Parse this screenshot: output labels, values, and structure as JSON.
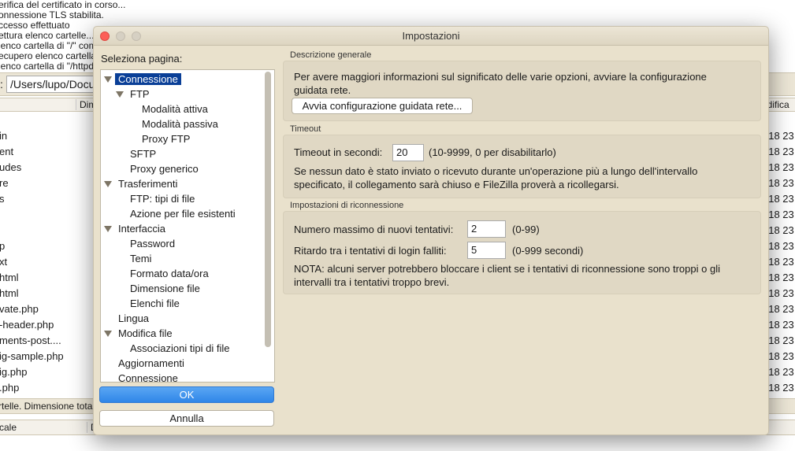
{
  "background": {
    "log_lines": [
      "erifica del certificato in corso...",
      "onnessione TLS stabilita.",
      "ccesso effettuato",
      "ettura elenco cartelle...",
      "lenco cartella di \"/\" com",
      "ecupero elenco cartella",
      "lenco cartella di \"/httpd"
    ],
    "path_label": ":",
    "path_value": "/Users/lupo/Docur",
    "col_name": "",
    "col_size": "Dim",
    "col_modified": "odifica",
    "files": [
      "in",
      "ent",
      "udes",
      "re",
      "s",
      "",
      "",
      "p",
      "xt",
      "html",
      "html",
      "vate.php",
      "-header.php",
      "ments-post....",
      "ig-sample.php",
      "ig.php",
      ".php"
    ],
    "dates": [
      "018 23",
      "018 23",
      "018 23",
      "018 23",
      "018 23",
      "018 23",
      "018 23",
      "018 23",
      "018 23",
      "018 23",
      "018 23",
      "018 23",
      "018 23",
      "018 23",
      "018 23",
      "018 23",
      "018 23"
    ],
    "status": "rtelle. Dimensione tota",
    "bottom_col1": "cale",
    "bottom_col2": "D"
  },
  "dialog": {
    "title": "Impostazioni",
    "select_page_label": "Seleziona pagina:",
    "tree": [
      {
        "label": "Connessione",
        "level": 0,
        "expanded": true,
        "selected": true
      },
      {
        "label": "FTP",
        "level": 1,
        "expanded": true
      },
      {
        "label": "Modalità attiva",
        "level": 2
      },
      {
        "label": "Modalità passiva",
        "level": 2
      },
      {
        "label": "Proxy FTP",
        "level": 2
      },
      {
        "label": "SFTP",
        "level": 1
      },
      {
        "label": "Proxy generico",
        "level": 1
      },
      {
        "label": "Trasferimenti",
        "level": 0,
        "expanded": true
      },
      {
        "label": "FTP: tipi di file",
        "level": 1
      },
      {
        "label": "Azione per file esistenti",
        "level": 1
      },
      {
        "label": "Interfaccia",
        "level": 0,
        "expanded": true
      },
      {
        "label": "Password",
        "level": 1
      },
      {
        "label": "Temi",
        "level": 1
      },
      {
        "label": "Formato data/ora",
        "level": 1
      },
      {
        "label": "Dimensione file",
        "level": 1
      },
      {
        "label": "Elenchi file",
        "level": 1
      },
      {
        "label": "Lingua",
        "level": 0
      },
      {
        "label": "Modifica file",
        "level": 0,
        "expanded": true
      },
      {
        "label": "Associazioni tipi di file",
        "level": 1
      },
      {
        "label": "Aggiornamenti",
        "level": 0
      },
      {
        "label": "Connessione",
        "level": 0
      }
    ],
    "ok_label": "OK",
    "cancel_label": "Annulla",
    "general": {
      "title": "Descrizione generale",
      "text1": "Per avere maggiori informazioni sul significato delle varie opzioni, avviare la configurazione",
      "text2": "guidata rete.",
      "wizard_button": "Avvia configurazione guidata rete..."
    },
    "timeout": {
      "title": "Timeout",
      "label": "Timeout in secondi:",
      "value": "20",
      "hint": "(10-9999, 0 per disabilitarlo)",
      "text1": "Se nessun dato è stato inviato o ricevuto durante un'operazione più a lungo dell'intervallo",
      "text2": "specificato, il collegamento sarà chiuso e FileZilla proverà a ricollegarsi."
    },
    "reconnect": {
      "title": "Impostazioni di riconnessione",
      "retries_label": "Numero massimo di nuovi tentativi:",
      "retries_value": "2",
      "retries_hint": "(0-99)",
      "delay_label": "Ritardo tra i tentativi di login falliti:",
      "delay_value": "5",
      "delay_hint": "(0-999 secondi)",
      "note1": "NOTA: alcuni server potrebbero bloccare i client se i tentativi di riconnessione sono troppi o gli",
      "note2": "intervalli tra i tentativi troppo brevi."
    }
  },
  "colors": {
    "accent": "#0a3f97",
    "ok_button": "#2f86e8",
    "dialog_bg": "#e9e1cc",
    "group_bg": "#e0d8c4"
  }
}
